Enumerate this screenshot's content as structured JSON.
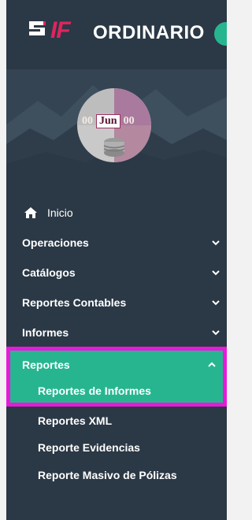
{
  "header": {
    "logo_text": "IF",
    "title": "ORDINARIO"
  },
  "profile": {
    "date_day": "00",
    "date_month": "Jun",
    "date_year": "00"
  },
  "menu": {
    "inicio": "Inicio",
    "items": [
      {
        "label": "Operaciones",
        "icon": "chevron-down-icon"
      },
      {
        "label": "Catálogos",
        "icon": "chevron-down-icon"
      },
      {
        "label": "Reportes Contables",
        "icon": "chevron-down-icon"
      },
      {
        "label": "Informes",
        "icon": "chevron-down-icon"
      }
    ],
    "reportes": {
      "label": "Reportes",
      "icon": "chevron-up-icon",
      "subitems": [
        {
          "label": "Reportes de Informes",
          "active": true
        },
        {
          "label": "Reportes XML"
        },
        {
          "label": "Reporte Evidencias"
        },
        {
          "label": "Reporte Masivo de Pólizas"
        }
      ]
    }
  },
  "colors": {
    "sidebar_bg": "#2b3845",
    "accent_green": "#27b590",
    "highlight_border": "#e81ad9",
    "logo_pink": "#e0245e"
  }
}
